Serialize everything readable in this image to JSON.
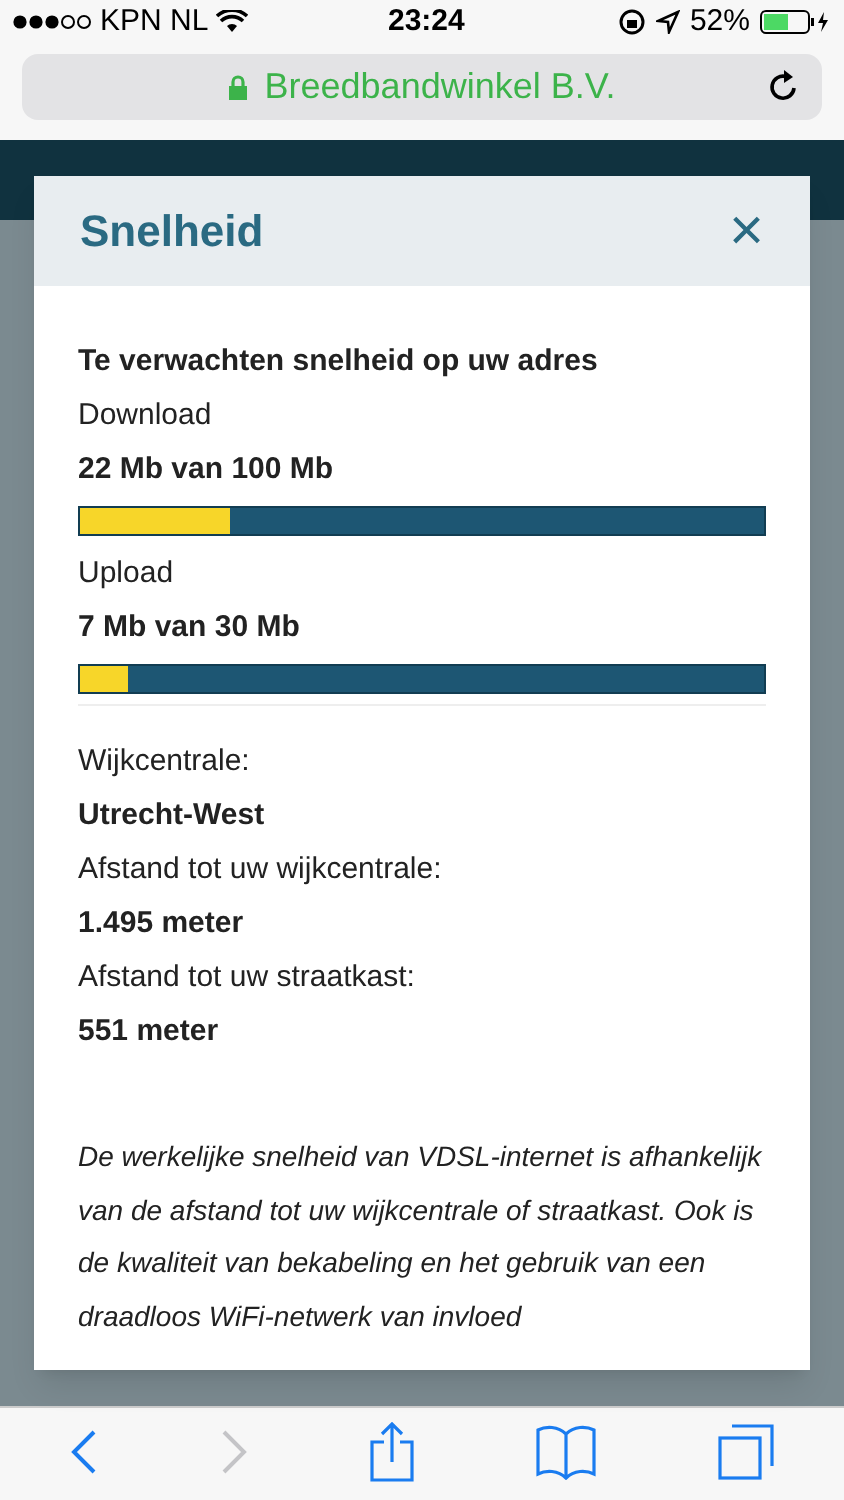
{
  "status_bar": {
    "carrier": "KPN NL",
    "time": "23:24",
    "battery": "52%"
  },
  "address_bar": {
    "site": "Breedbandwinkel B.V."
  },
  "modal": {
    "title": "Snelheid",
    "close": "×",
    "heading": "Te verwachten snelheid op uw adres",
    "meters": [
      {
        "label": "Download",
        "reading": "22 Mb van 100 Mb",
        "level": 0.22
      },
      {
        "label": "Upload",
        "reading": "7 Mb van 30 Mb",
        "level": 0.07
      }
    ],
    "details": [
      {
        "label": "Wijkcentrale:",
        "value": "Utrecht-West"
      },
      {
        "label": "Afstand tot uw wijkcentrale:",
        "value": "1.495 meter"
      },
      {
        "label": "Afstand tot uw straatkast:",
        "value": "551 meter"
      }
    ],
    "note": "De werkelijke snelheid van VDSL-internet is afhankelijk van de afstand tot uw wijkcentrale of straatkast. Ook is de kwaliteit van bekabeling en het gebruik van een draadloos WiFi-netwerk van invloed"
  }
}
